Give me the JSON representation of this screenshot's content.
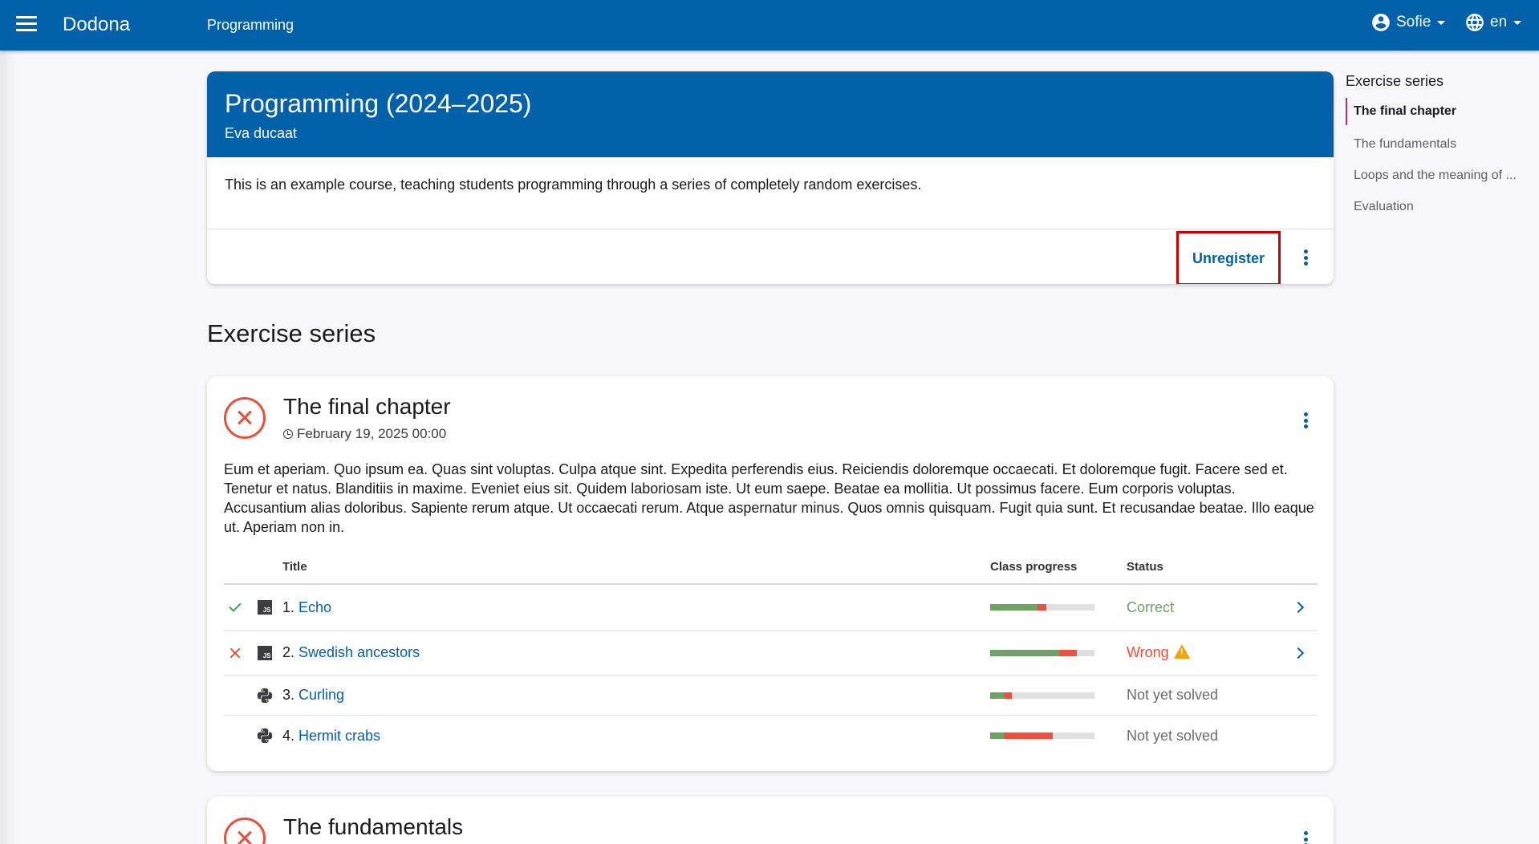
{
  "header": {
    "brand": "Dodona",
    "breadcrumb": "Programming",
    "user": "Sofie",
    "language": "en"
  },
  "course": {
    "title": "Programming (2024–2025)",
    "teacher": "Eva ducaat",
    "description": "This is an example course, teaching students programming through a series of completely random exercises.",
    "unregister_label": "Unregister"
  },
  "section_heading": "Exercise series",
  "series": [
    {
      "title": "The final chapter",
      "deadline": "February 19, 2025 00:00",
      "description": "Eum et aperiam. Quo ipsum ea. Quas sint voluptas. Culpa atque sint. Expedita perferendis eius. Reiciendis doloremque occaecati. Et doloremque fugit. Facere sed et. Tenetur et natus. Blanditiis in maxime. Eveniet eius sit. Quidem laboriosam iste. Ut eum saepe. Beatae ea mollitia. Ut possimus facere. Eum corporis voluptas. Accusantium alias doloribus. Sapiente rerum atque. Ut occaecati rerum. Atque aspernatur minus. Quos omnis quisquam. Fugit quia sunt. Et recusandae beatae. Illo eaque ut. Aperiam non in.",
      "columns": {
        "title": "Title",
        "progress": "Class progress",
        "status": "Status"
      },
      "exercises": [
        {
          "number": "1.",
          "name": "Echo",
          "language": "JS",
          "result": "correct",
          "status": "Correct",
          "status_color": "#6fa165",
          "progress_correct": 0.45,
          "progress_wrong": 0.09
        },
        {
          "number": "2.",
          "name": "Swedish ancestors",
          "language": "JS",
          "result": "wrong",
          "status": "Wrong",
          "status_color": "#e8503b",
          "progress_correct": 0.66,
          "progress_wrong": 0.17
        },
        {
          "number": "3.",
          "name": "Curling",
          "language": "python",
          "result": "none",
          "status": "Not yet solved",
          "status_color": "#6b6b72",
          "progress_correct": 0.13,
          "progress_wrong": 0.08
        },
        {
          "number": "4.",
          "name": "Hermit crabs",
          "language": "python",
          "result": "none",
          "status": "Not yet solved",
          "status_color": "#6b6b72",
          "progress_correct": 0.13,
          "progress_wrong": 0.47
        }
      ]
    },
    {
      "title": "The fundamentals"
    }
  ],
  "sidebar": {
    "heading": "Exercise series",
    "items": [
      {
        "label": "The final chapter",
        "active": true
      },
      {
        "label": "The fundamentals"
      },
      {
        "label": "Loops and the meaning of ..."
      },
      {
        "label": "Evaluation"
      }
    ]
  },
  "colors": {
    "primary": "#0261a8",
    "wrong": "#e8503b",
    "correct": "#6fa165",
    "highlight": "#cc0000"
  }
}
